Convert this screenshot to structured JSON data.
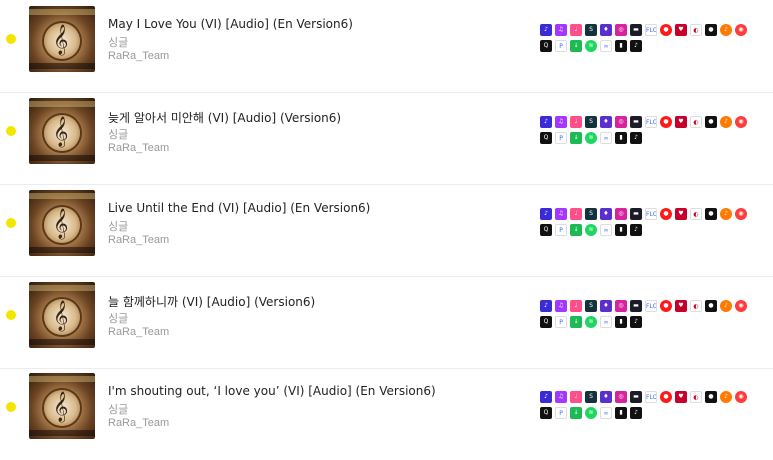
{
  "colors": {
    "status_dot": "#f2e600",
    "title_text": "#222222",
    "meta_text": "#9a9a9a",
    "divider": "#ececec"
  },
  "tracks": [
    {
      "title": "May I Love You (VI) [Audio] (En Version6)",
      "type": "싱글",
      "artist": "RaRa_Team"
    },
    {
      "title": "늦게 알아서 미안해 (VI) [Audio] (Version6)",
      "type": "싱글",
      "artist": "RaRa_Team"
    },
    {
      "title": "Live Until the End (VI) [Audio] (En Version6)",
      "type": "싱글",
      "artist": "RaRa_Team"
    },
    {
      "title": "늘 함께하니까 (VI) [Audio] (Version6)",
      "type": "싱글",
      "artist": "RaRa_Team"
    },
    {
      "title": "I'm shouting out, ‘I love you’ (VI) [Audio] (En Version6)",
      "type": "싱글",
      "artist": "RaRa_Team"
    }
  ],
  "platform_icons_row1": [
    {
      "name": "amazon-music-icon",
      "color": "#3b2bd6",
      "glyph": "♪"
    },
    {
      "name": "deezer-icon",
      "color": "#a238ff",
      "glyph": "♫"
    },
    {
      "name": "melon-icon",
      "color": "#ff4f8b",
      "glyph": "♩"
    },
    {
      "name": "shazam-icon",
      "color": "#13323e",
      "glyph": "S"
    },
    {
      "name": "tidal-icon",
      "color": "#5a2fcf",
      "glyph": "♦"
    },
    {
      "name": "instagram-icon",
      "color": "#d6249f",
      "glyph": "◎"
    },
    {
      "name": "pandora-dark-icon",
      "color": "#1b1b2a",
      "glyph": "▬"
    },
    {
      "name": "flo-icon",
      "color": "#ffffff",
      "glyph": "FLO",
      "text": "#3b6cff",
      "outline": true
    },
    {
      "name": "youtube-music-icon",
      "color": "#ff1a1a",
      "glyph": "●",
      "round": true
    },
    {
      "name": "iheartradio-icon",
      "color": "#c6002b",
      "glyph": "♥"
    },
    {
      "name": "kkbox-icon",
      "color": "#ffffff",
      "glyph": "◐",
      "text": "#d0021b",
      "outline": true
    },
    {
      "name": "napster-icon",
      "color": "#111111",
      "glyph": "●"
    },
    {
      "name": "soundcloud-icon",
      "color": "#ff7a00",
      "glyph": "♪",
      "round": true
    },
    {
      "name": "bugs-icon",
      "color": "#ff3b3b",
      "glyph": "◉",
      "round": true
    }
  ],
  "platform_icons_row2": [
    {
      "name": "qobuz-icon",
      "color": "#111111",
      "glyph": "Q"
    },
    {
      "name": "pandora-icon",
      "color": "#ffffff",
      "glyph": "P",
      "text": "#3668ff",
      "outline": true
    },
    {
      "name": "audiomack-icon",
      "color": "#1db954",
      "glyph": "↓"
    },
    {
      "name": "spotify-icon",
      "color": "#1ed760",
      "glyph": "≋",
      "round": true
    },
    {
      "name": "anghami-icon",
      "color": "#ffffff",
      "glyph": "∞",
      "text": "#4a6cf7",
      "outline": true
    },
    {
      "name": "yandex-icon",
      "color": "#111111",
      "glyph": "▮"
    },
    {
      "name": "tiktok-icon",
      "color": "#111111",
      "glyph": "♪"
    }
  ]
}
